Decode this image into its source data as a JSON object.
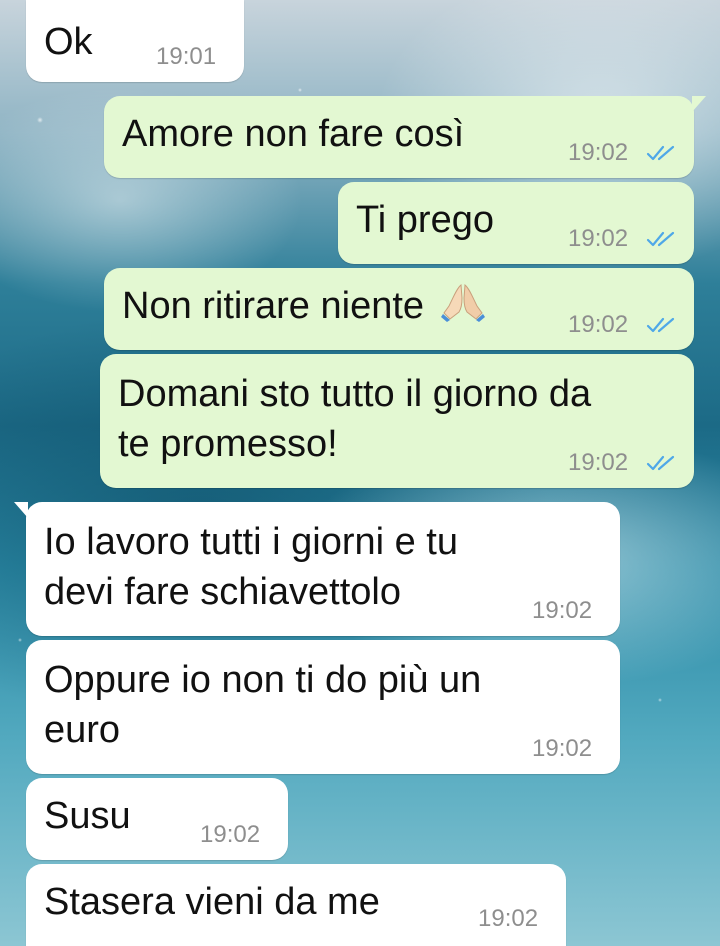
{
  "chat": {
    "messages": [
      {
        "direction": "incoming",
        "text": "Ok",
        "time": "19:01"
      },
      {
        "direction": "outgoing",
        "text": "Amore non fare così",
        "time": "19:02",
        "status": "read-double-check-icon"
      },
      {
        "direction": "outgoing",
        "text": "Ti prego",
        "time": "19:02",
        "status": "read-double-check-icon"
      },
      {
        "direction": "outgoing",
        "text": "Non ritirare niente",
        "emoji": "folded-hands-emoji",
        "time": "19:02",
        "status": "read-double-check-icon"
      },
      {
        "direction": "outgoing",
        "text_line1": "Domani sto tutto il giorno da",
        "text_line2": "te promesso!",
        "time": "19:02",
        "status": "read-double-check-icon"
      },
      {
        "direction": "incoming",
        "text_line1": "Io lavoro tutti i giorni e tu",
        "text_line2": "devi fare schiavettolo",
        "time": "19:02"
      },
      {
        "direction": "incoming",
        "text_line1": "Oppure io non ti do più un",
        "text_line2": "euro",
        "time": "19:02"
      },
      {
        "direction": "incoming",
        "text": "Susu",
        "time": "19:02"
      },
      {
        "direction": "incoming",
        "text": "Stasera vieni da me",
        "time": "19:02"
      }
    ]
  },
  "colors": {
    "incoming_bubble": "#ffffff",
    "outgoing_bubble": "#e3f8d2",
    "read_tick": "#4fa8e8",
    "timestamp": "#8e8e8e"
  }
}
